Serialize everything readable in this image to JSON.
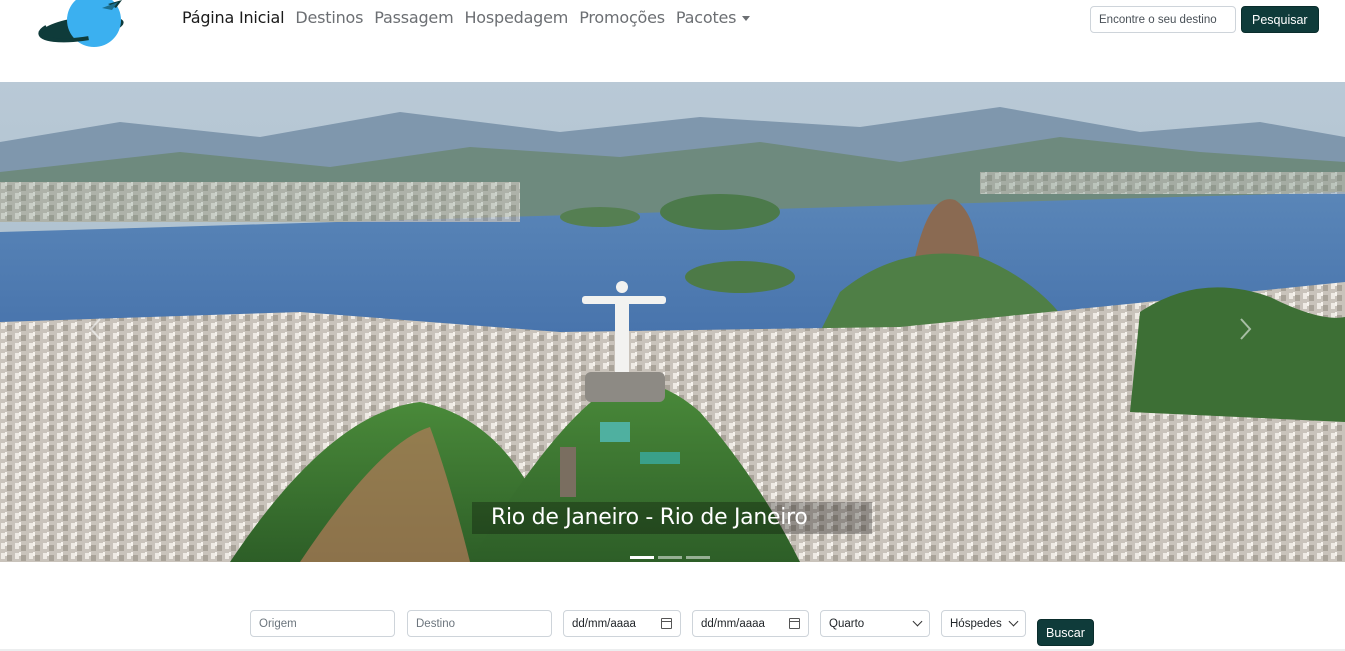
{
  "navbar": {
    "links": [
      {
        "label": "Página Inicial",
        "active": true
      },
      {
        "label": "Destinos"
      },
      {
        "label": "Passagem"
      },
      {
        "label": "Hospedagem"
      },
      {
        "label": "Promoções"
      },
      {
        "label": "Pacotes",
        "dropdown": true
      }
    ],
    "search": {
      "placeholder": "Encontre o seu destino",
      "button_label": "Pesquisar"
    }
  },
  "hero": {
    "caption": "Rio de Janeiro - Rio de Janeiro",
    "slides_count": 3,
    "active_slide": 1
  },
  "booking": {
    "origin_placeholder": "Origem",
    "destination_placeholder": "Destino",
    "date_in": "dd/mm/aaaa",
    "date_out": "dd/mm/aaaa",
    "room_selected": "Quarto",
    "guests_selected": "Hóspedes",
    "submit_label": "Buscar"
  },
  "colors": {
    "primary_button": "#0f3b3a",
    "logo_blue": "#3bb0f0",
    "logo_dark": "#0f3b3a"
  }
}
